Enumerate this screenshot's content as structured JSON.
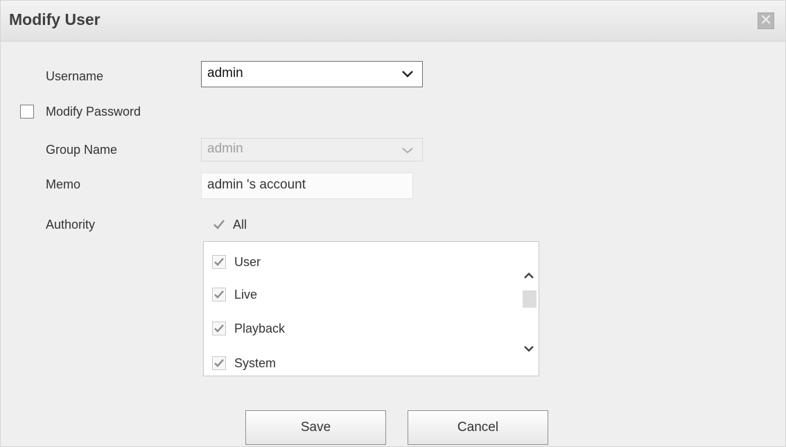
{
  "dialog": {
    "title": "Modify User",
    "close_icon": "close-icon"
  },
  "form": {
    "username_label": "Username",
    "username_value": "admin",
    "modify_password_label": "Modify Password",
    "group_name_label": "Group Name",
    "group_name_value": "admin",
    "memo_label": "Memo",
    "memo_value": "admin 's account",
    "authority_label": "Authority",
    "all_label": "All",
    "authorities": [
      {
        "label": "User",
        "checked": true
      },
      {
        "label": "Live",
        "checked": true
      },
      {
        "label": "Playback",
        "checked": true
      },
      {
        "label": "System",
        "checked": true
      }
    ]
  },
  "buttons": {
    "save_label": "Save",
    "cancel_label": "Cancel"
  },
  "colors": {
    "background": "#efefef",
    "title_text": "#3f3f3f",
    "check": "#8f8f8f"
  }
}
